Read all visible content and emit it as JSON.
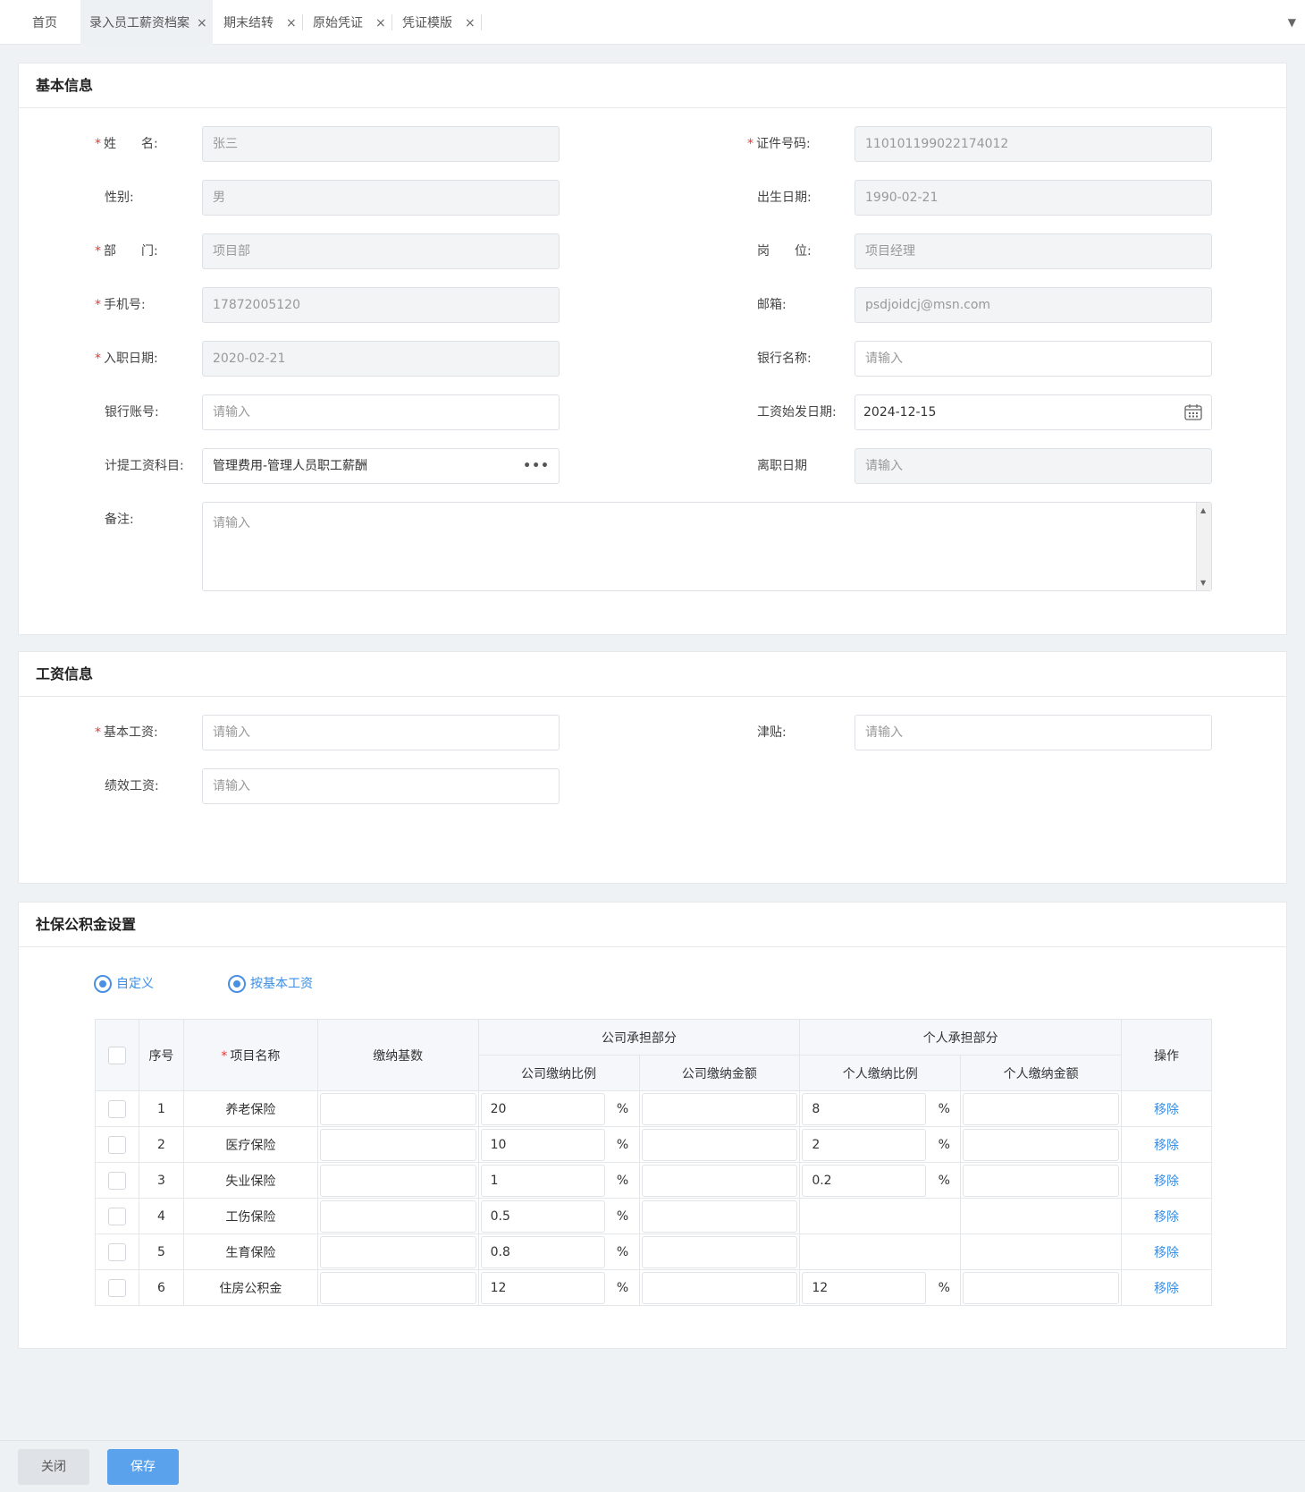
{
  "tabs": [
    {
      "label": "首页",
      "closable": false,
      "active": false
    },
    {
      "label": "录入员工薪资档案",
      "closable": true,
      "active": true
    },
    {
      "label": "期末结转",
      "closable": true,
      "active": false
    },
    {
      "label": "原始凭证",
      "closable": true,
      "active": false
    },
    {
      "label": "凭证模版",
      "closable": true,
      "active": false
    }
  ],
  "tab_close_glyph": "×",
  "tab_dropdown_glyph": "▼",
  "basic": {
    "title": "基本信息",
    "name_label": "姓　　名:",
    "name_value": "张三",
    "id_label": "证件号码:",
    "id_value": "110101199022174012",
    "gender_label": "性别:",
    "gender_value": "男",
    "birth_label": "出生日期:",
    "birth_value": "1990-02-21",
    "dept_label": "部　　门:",
    "dept_value": "项目部",
    "post_label": "岗　　位:",
    "post_value": "项目经理",
    "phone_label": "手机号:",
    "phone_value": "17872005120",
    "email_label": "邮箱:",
    "email_value": "psdjoidcj@msn.com",
    "join_label": "入职日期:",
    "join_value": "2020-02-21",
    "bank_name_label": "银行名称:",
    "bank_name_placeholder": "请输入",
    "bank_acct_label": "银行账号:",
    "bank_acct_placeholder": "请输入",
    "pay_start_label": "工资始发日期:",
    "pay_start_value": "2024-12-15",
    "subject_label": "计提工资科目:",
    "subject_value": "管理费用-管理人员职工薪酬",
    "subject_more": "•••",
    "leave_label": "离职日期",
    "leave_placeholder": "请输入",
    "remark_label": "备注:",
    "remark_placeholder": "请输入"
  },
  "salary": {
    "title": "工资信息",
    "base_label": "基本工资:",
    "base_placeholder": "请输入",
    "allowance_label": "津贴:",
    "allowance_placeholder": "请输入",
    "perf_label": "绩效工资:",
    "perf_placeholder": "请输入"
  },
  "social": {
    "title": "社保公积金设置",
    "radio_custom": "自定义",
    "radio_base": "按基本工资",
    "headers": {
      "seq": "序号",
      "name": "项目名称",
      "base": "缴纳基数",
      "company": "公司承担部分",
      "company_rate": "公司缴纳比例",
      "company_amount": "公司缴纳金额",
      "personal": "个人承担部分",
      "personal_rate": "个人缴纳比例",
      "personal_amount": "个人缴纳金额",
      "op": "操作"
    },
    "pct": "%",
    "remove_label": "移除",
    "rows": [
      {
        "seq": "1",
        "name": "养老保险",
        "company_rate": "20",
        "personal_rate": "8",
        "has_personal": true
      },
      {
        "seq": "2",
        "name": "医疗保险",
        "company_rate": "10",
        "personal_rate": "2",
        "has_personal": true
      },
      {
        "seq": "3",
        "name": "失业保险",
        "company_rate": "1",
        "personal_rate": "0.2",
        "has_personal": true
      },
      {
        "seq": "4",
        "name": "工伤保险",
        "company_rate": "0.5",
        "personal_rate": "",
        "has_personal": false
      },
      {
        "seq": "5",
        "name": "生育保险",
        "company_rate": "0.8",
        "personal_rate": "",
        "has_personal": false
      },
      {
        "seq": "6",
        "name": "住房公积金",
        "company_rate": "12",
        "personal_rate": "12",
        "has_personal": true
      }
    ]
  },
  "footer": {
    "close_label": "关闭",
    "save_label": "保存"
  },
  "colors": {
    "accent": "#4a90e2",
    "required": "#e53935",
    "save_button": "#5aa2eb"
  }
}
